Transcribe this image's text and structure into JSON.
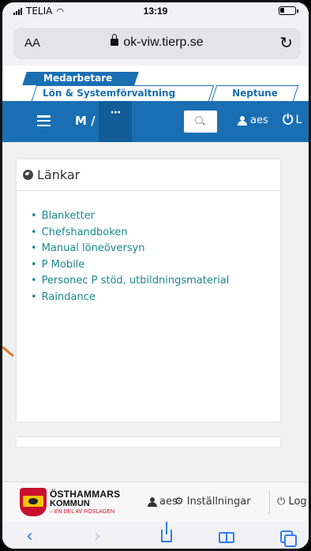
{
  "status": {
    "carrier": "TELIA",
    "time": "13:19"
  },
  "browser": {
    "text_size": "AA",
    "url": "ok-viw.tierp.se"
  },
  "site_tabs": {
    "active": "Medarbetare",
    "tab2": "Lön & Systemförvaltning",
    "tab3": "Neptune"
  },
  "nav": {
    "m_label": "M /",
    "more_label": "···",
    "user_label": "aes",
    "logout_label": "L"
  },
  "card": {
    "title": "Länkar",
    "links": [
      "Blanketter",
      "Chefshandboken",
      "Manual löneöversyn",
      "P Mobile",
      "Personec P stöd, utbildningsmaterial",
      "Raindance"
    ]
  },
  "footer": {
    "logo_line1": "ÖSTHAMMARS",
    "logo_line2": "KOMMUN",
    "logo_line3": "– EN DEL AV ROSLAGEN",
    "user_label": "aes",
    "settings_label": "Inställningar",
    "logout_label": "Log"
  },
  "colors": {
    "brand": "#1a6fb3",
    "link": "#1a8a8a",
    "ios_blue": "#2f7cf6"
  }
}
